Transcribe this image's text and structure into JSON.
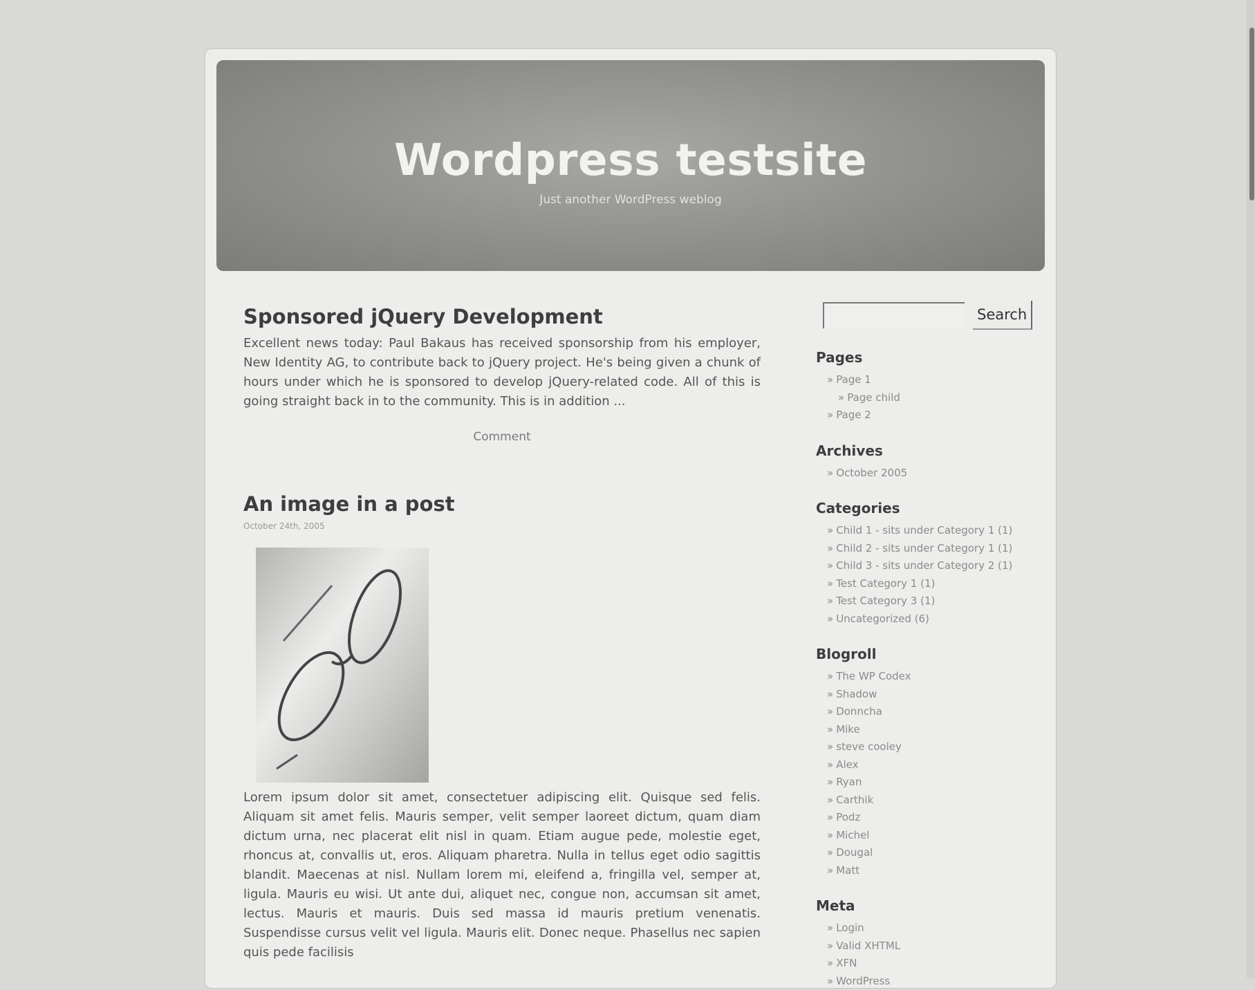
{
  "header": {
    "site_title": "Wordpress testsite",
    "site_description": "Just another WordPress weblog"
  },
  "posts": [
    {
      "title": "Sponsored jQuery Development",
      "excerpt": "Excellent news today: Paul Bakaus has received sponsorship from his employer, New Identity AG, to contribute back to jQuery project. He's being given a chunk of hours under which he is sponsored to develop jQuery-related code. All of this is going straight back in to the community. This is in addition ...",
      "comment_label": "Comment"
    },
    {
      "title": "An image in a post",
      "date": "October 24th, 2005",
      "body": "Lorem ipsum dolor sit amet, consectetuer adipiscing elit. Quisque sed felis. Aliquam sit amet felis. Mauris semper, velit semper laoreet dictum, quam diam dictum urna, nec placerat elit nisl in quam. Etiam augue pede, molestie eget, rhoncus at, convallis ut, eros. Aliquam pharetra. Nulla in tellus eget odio sagittis blandit. Maecenas at nisl. Nullam lorem mi, eleifend a, fringilla vel, semper at, ligula. Mauris eu wisi. Ut ante dui, aliquet nec, congue non, accumsan sit amet, lectus. Mauris et mauris. Duis sed massa id mauris pretium venenatis. Suspendisse cursus velit vel ligula. Mauris elit. Donec neque. Phasellus nec sapien quis pede facilisis"
    }
  ],
  "sidebar": {
    "search_button": "Search",
    "pages": {
      "title": "Pages",
      "items": [
        "Page 1",
        "Page child",
        "Page 2"
      ]
    },
    "archives": {
      "title": "Archives",
      "items": [
        "October 2005"
      ]
    },
    "categories": {
      "title": "Categories",
      "items": [
        "Child 1 - sits under Category 1 (1)",
        "Child 2 - sits under Category 1 (1)",
        "Child 3 - sits under Category 2 (1)",
        "Test Category 1 (1)",
        "Test Category 3 (1)",
        "Uncategorized (6)"
      ]
    },
    "blogroll": {
      "title": "Blogroll",
      "items": [
        "The WP Codex",
        "Shadow",
        "Donncha",
        "Mike",
        "steve cooley",
        "Alex",
        "Ryan",
        "Carthik",
        "Podz",
        "Michel",
        "Dougal",
        "Matt"
      ]
    },
    "meta": {
      "title": "Meta",
      "items": [
        "Login",
        "Valid XHTML",
        "XFN",
        "WordPress"
      ]
    }
  }
}
